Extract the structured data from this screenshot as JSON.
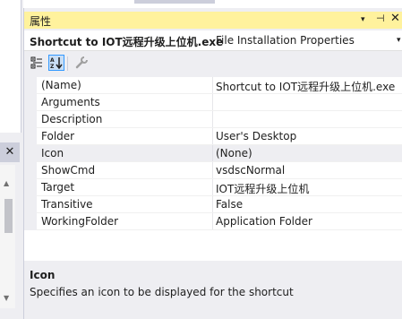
{
  "window": {
    "title": "属性",
    "buttons": {
      "dropdown": "▾",
      "pin": "⊣",
      "close": "✕"
    }
  },
  "object_selector": {
    "name": "Shortcut to IOT远程升级上位机.exe",
    "type": "File Installation Properties",
    "chevron": "▾"
  },
  "toolbar": {
    "categorized_icon": "categorized-icon",
    "alphabetical_icon": "alphabetical-icon",
    "property_pages_icon": "wrench-icon"
  },
  "properties": [
    {
      "name": "(Name)",
      "value": "Shortcut to IOT远程升级上位机.exe"
    },
    {
      "name": "Arguments",
      "value": ""
    },
    {
      "name": "Description",
      "value": ""
    },
    {
      "name": "Folder",
      "value": "User's Desktop"
    },
    {
      "name": "Icon",
      "value": "(None)"
    },
    {
      "name": "ShowCmd",
      "value": "vsdscNormal"
    },
    {
      "name": "Target",
      "value": "IOT远程升级上位机"
    },
    {
      "name": "Transitive",
      "value": "False"
    },
    {
      "name": "WorkingFolder",
      "value": "Application Folder"
    }
  ],
  "selected_property": "Icon",
  "description": {
    "title": "Icon",
    "text": "Specifies an icon to be displayed for the shortcut"
  },
  "left_panel": {
    "close": "✕"
  },
  "colors": {
    "title_bar": "#fff29d",
    "window_bg": "#eeeef2",
    "selected_toolbar_bg": "#c9def5",
    "selected_toolbar_border": "#3399ff"
  }
}
